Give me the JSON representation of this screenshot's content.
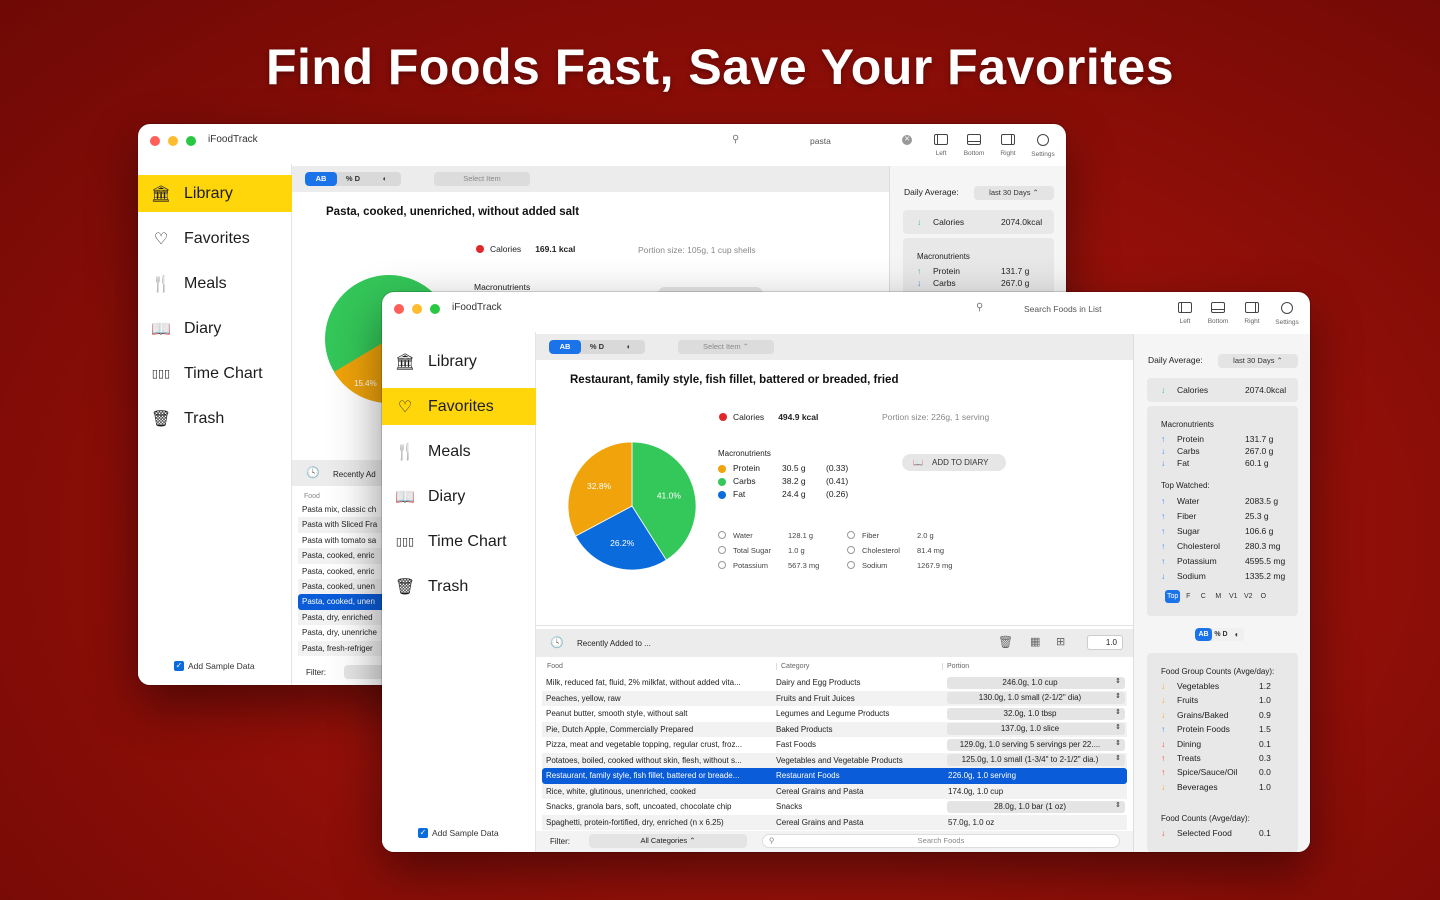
{
  "headline": "Find Foods Fast, Save Your Favorites",
  "back_window": {
    "app_title": "iFoodTrack",
    "search_value": "pasta",
    "toolbar": [
      "Left",
      "Bottom",
      "Right",
      "Settings"
    ],
    "sidebar": [
      "Library",
      "Favorites",
      "Meals",
      "Diary",
      "Time Chart",
      "Trash"
    ],
    "segments": [
      "AB",
      "% D",
      ""
    ],
    "select_item": "Select Item",
    "food_title": "Pasta, cooked, unenriched, without added salt",
    "calories_label": "Calories",
    "calories_value": "169.1 kcal",
    "portion": "Portion size: 105g, 1 cup shells",
    "macros_label": "Macronutrients",
    "pie_label": "15.4%",
    "daily_average": "Daily Average:",
    "range": "last 30 Days",
    "calories_row": {
      "label": "Calories",
      "value": "2074.0kcal"
    },
    "macros": [
      {
        "label": "Protein",
        "value": "131.7 g"
      },
      {
        "label": "Carbs",
        "value": "267.0 g"
      }
    ],
    "recently": "Recently Ad",
    "food_col": "Food",
    "list": [
      "Pasta mix, classic ch",
      "Pasta with Sliced Fra",
      "Pasta with tomato sa",
      "Pasta, cooked, enric",
      "Pasta, cooked, enric",
      "Pasta, cooked, unen",
      "Pasta, cooked, unen",
      "Pasta, dry, enriched",
      "Pasta, dry, unenriche",
      "Pasta, fresh-refriger"
    ],
    "add_sample": "Add Sample Data",
    "filter": "Filter:"
  },
  "front_window": {
    "app_title": "iFoodTrack",
    "search_placeholder": "Search Foods in List",
    "toolbar": [
      "Left",
      "Bottom",
      "Right",
      "Settings"
    ],
    "sidebar": [
      "Library",
      "Favorites",
      "Meals",
      "Diary",
      "Time Chart",
      "Trash"
    ],
    "segments": [
      "AB",
      "% D",
      ""
    ],
    "select_item": "Select Item",
    "food_title": "Restaurant, family style, fish fillet, battered or breaded, fried",
    "calories_label": "Calories",
    "calories_value": "494.9 kcal",
    "portion": "Portion size: 226g, 1 serving",
    "macros_label": "Macronutrients",
    "macros": [
      {
        "label": "Protein",
        "value": "30.5 g",
        "ratio": "(0.33)",
        "color": "#f0a30a"
      },
      {
        "label": "Carbs",
        "value": "38.2 g",
        "ratio": "(0.41)",
        "color": "#34c759"
      },
      {
        "label": "Fat",
        "value": "24.4 g",
        "ratio": "(0.26)",
        "color": "#0a6bdc"
      }
    ],
    "pie": [
      {
        "label": "41.0%",
        "value": 41.0,
        "color": "#34c759"
      },
      {
        "label": "26.2%",
        "value": 26.2,
        "color": "#0a6bdc"
      },
      {
        "label": "32.8%",
        "value": 32.8,
        "color": "#f0a30a"
      }
    ],
    "add_to_diary": "ADD TO DIARY",
    "nutrients_left": [
      {
        "label": "Water",
        "value": "128.1 g"
      },
      {
        "label": "Total Sugar",
        "value": "1.0 g"
      },
      {
        "label": "Potassium",
        "value": "567.3 mg"
      }
    ],
    "nutrients_right": [
      {
        "label": "Fiber",
        "value": "2.0 g"
      },
      {
        "label": "Cholesterol",
        "value": "81.4 mg"
      },
      {
        "label": "Sodium",
        "value": "1267.9 mg"
      }
    ],
    "recently": "Recently Added to ...",
    "zoom_value": "1.0",
    "columns": [
      "Food",
      "Category",
      "Portion"
    ],
    "rows": [
      {
        "food": "Milk, reduced fat, fluid, 2% milkfat, without added vita...",
        "category": "Dairy and Egg Products",
        "portion": "246.0g, 1.0 cup",
        "stepper": true
      },
      {
        "food": "Peaches, yellow, raw",
        "category": "Fruits and Fruit Juices",
        "portion": "130.0g, 1.0 small (2-1/2\" dia)",
        "stepper": true
      },
      {
        "food": "Peanut butter, smooth style, without salt",
        "category": "Legumes and Legume Products",
        "portion": "32.0g, 1.0 tbsp",
        "stepper": true
      },
      {
        "food": "Pie, Dutch Apple, Commercially Prepared",
        "category": "Baked Products",
        "portion": "137.0g, 1.0 slice",
        "stepper": true
      },
      {
        "food": "Pizza, meat and vegetable topping, regular crust, froz...",
        "category": "Fast Foods",
        "portion": "129.0g, 1.0 serving 5 servings per 22....",
        "stepper": true
      },
      {
        "food": "Potatoes, boiled, cooked without skin, flesh, without s...",
        "category": "Vegetables and Vegetable Products",
        "portion": "125.0g, 1.0 small (1-3/4\" to 2-1/2\" dia.)",
        "stepper": true
      },
      {
        "food": "Restaurant, family style, fish fillet, battered or breade...",
        "category": "Restaurant Foods",
        "portion": "226.0g, 1.0 serving",
        "stepper": false,
        "selected": true
      },
      {
        "food": "Rice, white, glutinous, unenriched, cooked",
        "category": "Cereal Grains and Pasta",
        "portion": "174.0g, 1.0 cup",
        "stepper": false
      },
      {
        "food": "Snacks, granola bars, soft, uncoated, chocolate chip",
        "category": "Snacks",
        "portion": "28.0g, 1.0 bar (1 oz)",
        "stepper": true
      },
      {
        "food": "Spaghetti, protein-fortified, dry, enriched (n x 6.25)",
        "category": "Cereal Grains and Pasta",
        "portion": "57.0g, 1.0 oz",
        "stepper": false
      }
    ],
    "filter": "Filter:",
    "filter_value": "All Categories",
    "search_foods": "Search Foods",
    "add_sample": "Add Sample Data",
    "daily_average": "Daily Average:",
    "range": "last 30 Days",
    "calories_row": {
      "label": "Calories",
      "value": "2074.0kcal"
    },
    "right_macros_label": "Macronutrients",
    "right_macros": [
      {
        "label": "Protein",
        "value": "131.7 g",
        "dir": "up"
      },
      {
        "label": "Carbs",
        "value": "267.0 g",
        "dir": "down"
      },
      {
        "label": "Fat",
        "value": "60.1 g",
        "dir": "down"
      }
    ],
    "top_watched_label": "Top Watched:",
    "top_watched": [
      {
        "label": "Water",
        "value": "2083.5 g",
        "dir": "up"
      },
      {
        "label": "Fiber",
        "value": "25.3 g",
        "dir": "up"
      },
      {
        "label": "Sugar",
        "value": "106.6 g",
        "dir": "up"
      },
      {
        "label": "Cholesterol",
        "value": "280.3 mg",
        "dir": "up"
      },
      {
        "label": "Potassium",
        "value": "4595.5 mg",
        "dir": "up"
      },
      {
        "label": "Sodium",
        "value": "1335.2 mg",
        "dir": "down"
      }
    ],
    "filter_tabs": [
      "Top",
      "F",
      "C",
      "M",
      "V1",
      "V2",
      "O"
    ],
    "mini_segments": [
      "AB",
      "% D",
      ""
    ],
    "group_counts_label": "Food Group Counts (Avge/day):",
    "group_counts": [
      {
        "label": "Vegetables",
        "value": "1.2",
        "dir": "down",
        "color": "orange"
      },
      {
        "label": "Fruits",
        "value": "1.0",
        "dir": "down",
        "color": "orange"
      },
      {
        "label": "Grains/Baked",
        "value": "0.9",
        "dir": "down",
        "color": "orange"
      },
      {
        "label": "Protein Foods",
        "value": "1.5",
        "dir": "up",
        "color": "blue"
      },
      {
        "label": "Dining",
        "value": "0.1",
        "dir": "down",
        "color": "red"
      },
      {
        "label": "Treats",
        "value": "0.3",
        "dir": "up",
        "color": "red"
      },
      {
        "label": "Spice/Sauce/Oil",
        "value": "0.0",
        "dir": "up",
        "color": "red"
      },
      {
        "label": "Beverages",
        "value": "1.0",
        "dir": "down",
        "color": "orange"
      }
    ],
    "food_counts_label": "Food Counts (Avge/day):",
    "food_counts": [
      {
        "label": "Selected Food",
        "value": "0.1",
        "dir": "down",
        "color": "red"
      }
    ]
  }
}
